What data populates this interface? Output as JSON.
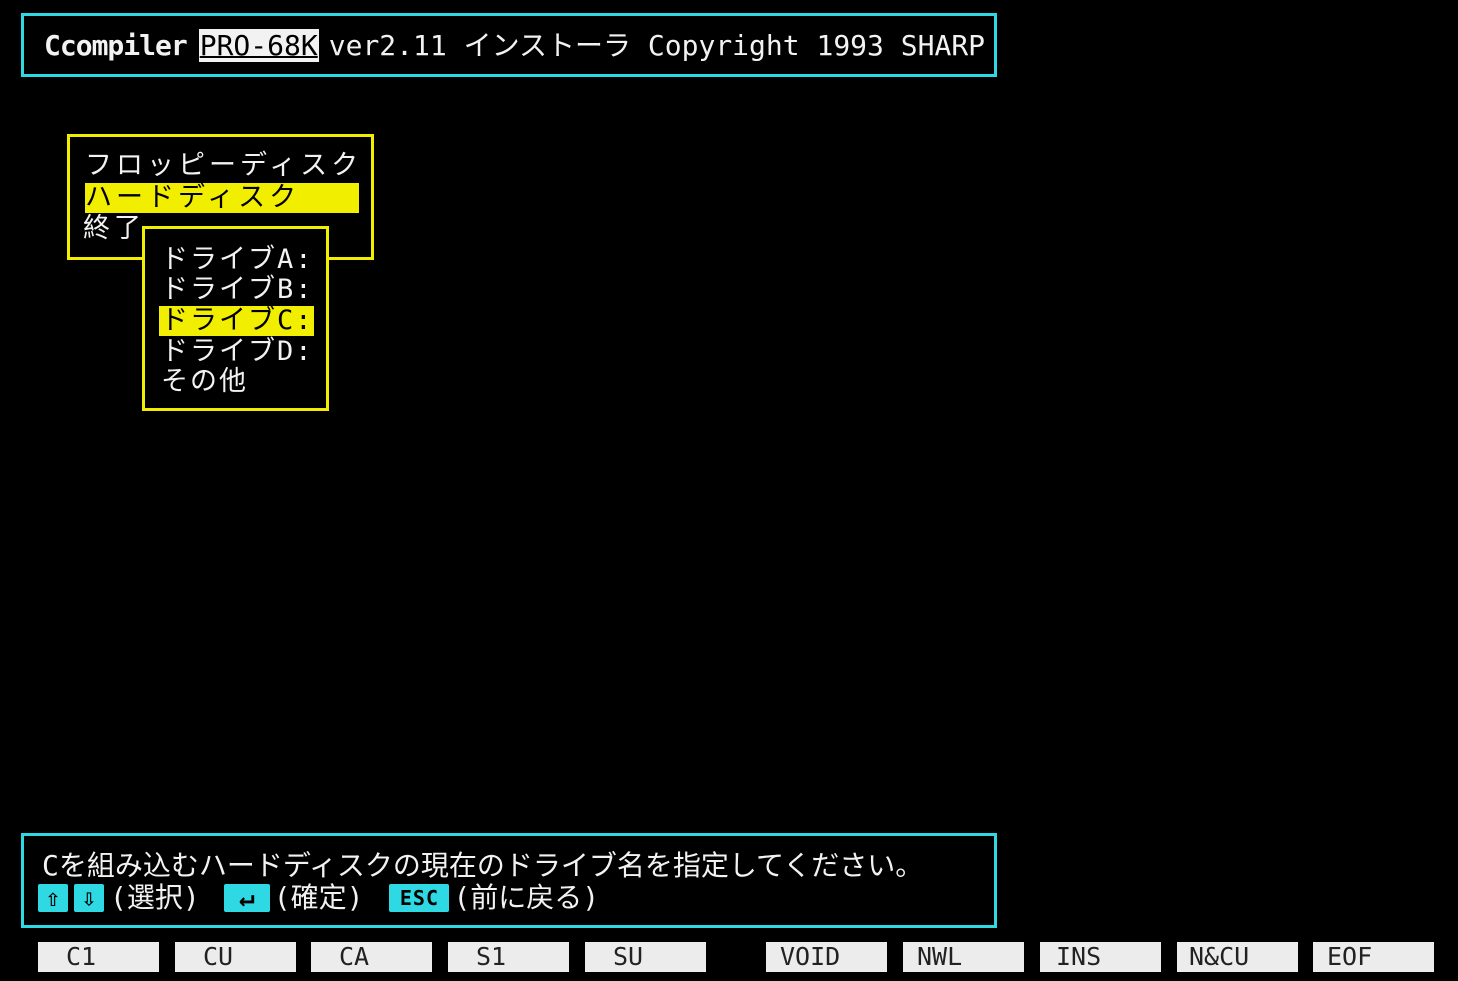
{
  "header": {
    "brand": "Ccompiler",
    "product": "PRO-68K",
    "rest": "ver2.11 インストーラ Copyright 1993 SHARP"
  },
  "main_menu": {
    "items": [
      "フロッピーディスク",
      "ハードディスク",
      "終了"
    ],
    "selected_index": 1
  },
  "drive_menu": {
    "items": [
      "ドライブA:",
      "ドライブB:",
      "ドライブC:",
      "ドライブD:",
      "その他"
    ],
    "selected_index": 2
  },
  "help": {
    "message": "Cを組み込むハードディスクの現在のドライブ名を指定してください。",
    "up_icon": "⇧",
    "down_icon": "⇩",
    "select_label": "(選択)",
    "enter_icon": "↵",
    "confirm_label": "(確定)",
    "esc_label": "ESC",
    "back_label": "(前に戻る)"
  },
  "function_keys": [
    "C1",
    "CU",
    "CA",
    "S1",
    "SU",
    "VOID",
    "NWL",
    "INS",
    "N&CU",
    "EOF"
  ],
  "colors": {
    "frame_cyan": "#2fd9e4",
    "menu_yellow": "#f2ee00",
    "background": "#000000",
    "fkey_bg": "#ececec"
  }
}
